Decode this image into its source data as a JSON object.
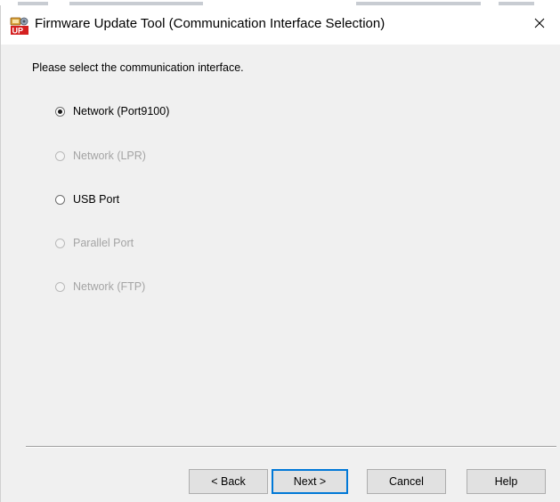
{
  "window": {
    "title": "Firmware Update Tool (Communication Interface Selection)",
    "close_glyph": "✕"
  },
  "prompt": "Please select the communication interface.",
  "options": [
    {
      "label": "Network (Port9100)",
      "checked": true,
      "enabled": true
    },
    {
      "label": "Network (LPR)",
      "checked": false,
      "enabled": false
    },
    {
      "label": "USB Port",
      "checked": false,
      "enabled": true
    },
    {
      "label": "Parallel Port",
      "checked": false,
      "enabled": false
    },
    {
      "label": "Network (FTP)",
      "checked": false,
      "enabled": false
    }
  ],
  "buttons": {
    "back": "< Back",
    "next": "Next >",
    "cancel": "Cancel",
    "help": "Help"
  },
  "icons": {
    "app": "firmware-update-app-icon",
    "close": "close-icon"
  },
  "colors": {
    "disabled_text": "#a4a4a4",
    "default_button_border": "#0078d7",
    "dialog_background": "#f0f0f0"
  }
}
